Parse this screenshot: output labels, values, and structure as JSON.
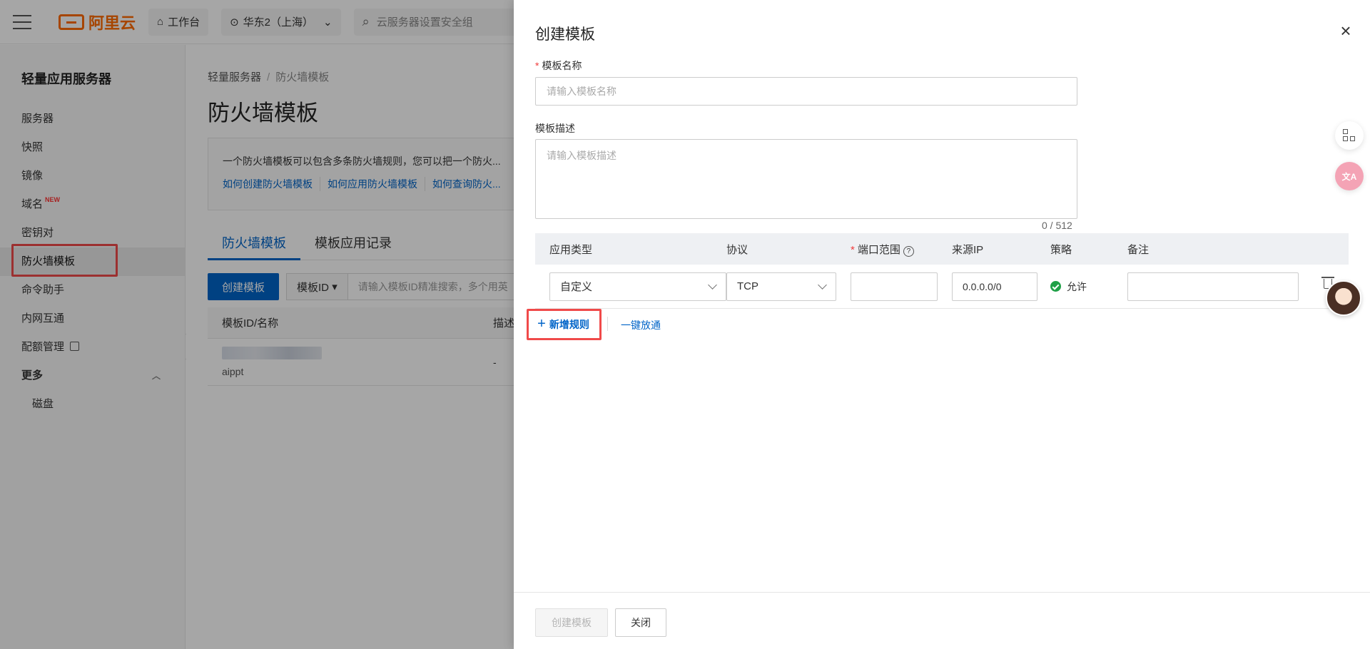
{
  "header": {
    "logo_text": "阿里云",
    "workbench_label": "工作台",
    "region_label": "华东2（上海）",
    "search_placeholder": "云服务器设置安全组"
  },
  "sidebar": {
    "title": "轻量应用服务器",
    "items": [
      {
        "label": "服务器"
      },
      {
        "label": "快照"
      },
      {
        "label": "镜像"
      },
      {
        "label": "域名",
        "badge": "NEW"
      },
      {
        "label": "密钥对"
      },
      {
        "label": "防火墙模板",
        "active": true
      },
      {
        "label": "命令助手"
      },
      {
        "label": "内网互通"
      },
      {
        "label": "配额管理"
      }
    ],
    "more_label": "更多",
    "sub_items": [
      {
        "label": "磁盘"
      }
    ]
  },
  "main": {
    "breadcrumb": [
      "轻量服务器",
      "防火墙模板"
    ],
    "title": "防火墙模板",
    "info_text": "一个防火墙模板可以包含多条防火墙规则，您可以把一个防火...",
    "info_links": [
      "如何创建防火墙模板",
      "如何应用防火墙模板",
      "如何查询防火..."
    ],
    "tabs": [
      "防火墙模板",
      "模板应用记录"
    ],
    "create_button": "创建模板",
    "filter_label": "模板ID",
    "filter_placeholder": "请输入模板ID精准搜索，多个用英",
    "table": {
      "headers": [
        "模板ID/名称",
        "描述"
      ],
      "rows": [
        {
          "name": "aippt",
          "desc": "-"
        }
      ]
    }
  },
  "drawer": {
    "title": "创建模板",
    "name_label": "模板名称",
    "name_placeholder": "请输入模板名称",
    "desc_label": "模板描述",
    "desc_placeholder": "请输入模板描述",
    "counter": "0 / 512",
    "rules": {
      "headers": [
        "应用类型",
        "协议",
        "端口范围",
        "来源IP",
        "策略",
        "备注"
      ],
      "row": {
        "app_type": "自定义",
        "protocol": "TCP",
        "port": "",
        "source_ip": "0.0.0.0/0",
        "policy": "允许",
        "remark": ""
      }
    },
    "add_rule": "新增规则",
    "one_key": "一键放通",
    "footer": {
      "create": "创建模板",
      "close": "关闭"
    }
  },
  "colors": {
    "accent": "#0064c8",
    "brand": "#ff6a00",
    "highlight": "#f04a4a",
    "allow": "#1fa047"
  }
}
